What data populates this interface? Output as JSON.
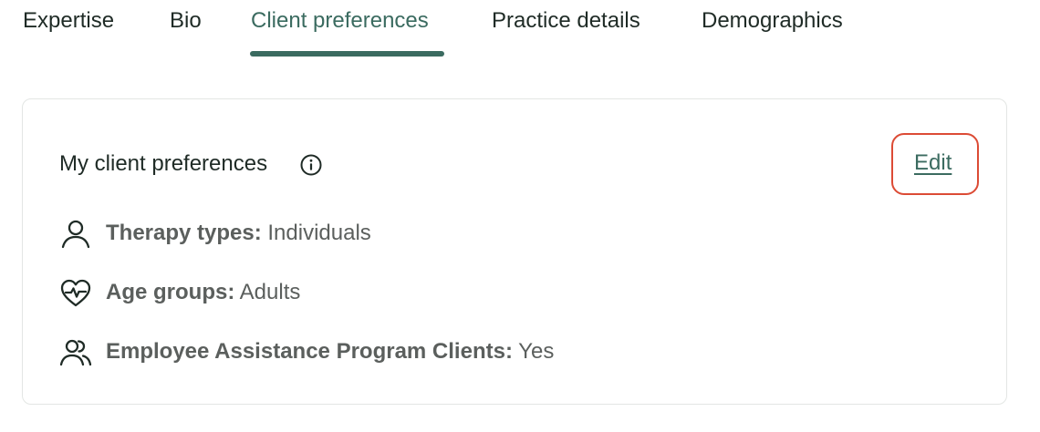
{
  "tabs": [
    {
      "label": "Expertise",
      "active": false
    },
    {
      "label": "Bio",
      "active": false
    },
    {
      "label": "Client preferences",
      "active": true
    },
    {
      "label": "Practice details",
      "active": false
    },
    {
      "label": "Demographics",
      "active": false
    }
  ],
  "card": {
    "title": "My client preferences",
    "info_icon": "info-icon",
    "edit_label": "Edit",
    "rows": [
      {
        "icon": "person-icon",
        "label": "Therapy types:",
        "value": " Individuals"
      },
      {
        "icon": "heart-pulse-icon",
        "label": "Age groups:",
        "value": " Adults"
      },
      {
        "icon": "users-icon",
        "label": "Employee Assistance Program Clients:",
        "value": " Yes"
      }
    ]
  },
  "colors": {
    "accent": "#3b6b60",
    "text": "#1f2b26",
    "muted": "#5b5f5d",
    "highlight": "#dc4b35",
    "border": "#e3e6e4"
  }
}
